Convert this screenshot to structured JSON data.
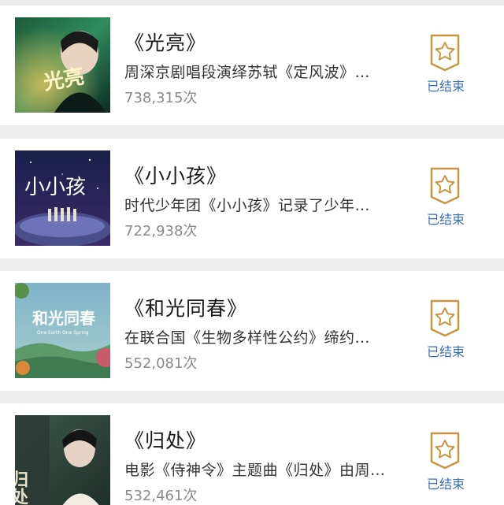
{
  "items": [
    {
      "title": "《光亮》",
      "description": "周深京剧唱段演绎苏轼《定风波》…",
      "count": "738,315次",
      "status": "已结束",
      "thumb_text": "光亮",
      "status_icon": "star-badge-icon"
    },
    {
      "title": "《小小孩》",
      "description": "时代少年团《小小孩》记录了少年…",
      "count": "722,938次",
      "status": "已结束",
      "thumb_text": "小小孩",
      "status_icon": "star-badge-icon"
    },
    {
      "title": "《和光同春》",
      "description": "在联合国《生物多样性公约》缔约…",
      "count": "552,081次",
      "status": "已结束",
      "thumb_text": "和光同春",
      "thumb_subtext": "One Earth One Spring",
      "status_icon": "star-badge-icon"
    },
    {
      "title": "《归处》",
      "description": "电影《侍神令》主题曲《归处》由周…",
      "count": "532,461次",
      "status": "已结束",
      "thumb_text": "归处",
      "status_icon": "star-badge-icon"
    }
  ],
  "colors": {
    "status_text": "#3a6fc0",
    "badge_gold": "#c8963e",
    "count_gray": "#8a8a8a",
    "background": "#ececec"
  }
}
